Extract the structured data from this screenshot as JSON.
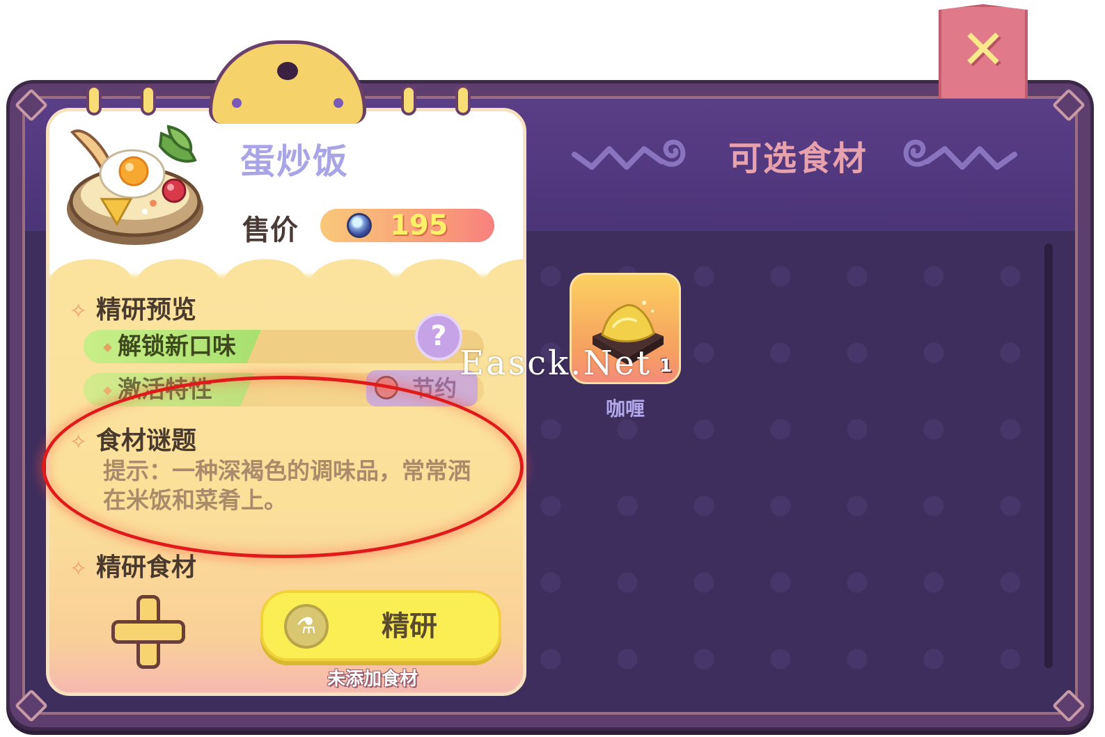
{
  "dish": {
    "name": "蛋炒饭",
    "price_label": "售价",
    "price_value": "195"
  },
  "preview": {
    "heading": "精研预览",
    "unlock_label": "解锁新口味",
    "trait_label": "激活特性",
    "trait_badge": "节约",
    "help_symbol": "?"
  },
  "puzzle": {
    "heading": "食材谜题",
    "hint": "提示：一种深褐色的调味品，常常洒在米饭和菜肴上。"
  },
  "refine": {
    "heading": "精研食材",
    "button_label": "精研",
    "status": "未添加食材"
  },
  "selectable": {
    "title": "可选食材",
    "items": [
      {
        "name": "咖喱",
        "count": "1",
        "icon": "curry-icon"
      }
    ]
  },
  "close_symbol": "✕",
  "watermark": "Easck.Net",
  "colors": {
    "panel_bg": "#3e2e5e",
    "card_top": "#ffffff",
    "card_yellow": "#fbe39e",
    "accent_yellow": "#fbee54",
    "close_red": "#e07a8a",
    "highlight_ellipse": "#e01a1a"
  }
}
